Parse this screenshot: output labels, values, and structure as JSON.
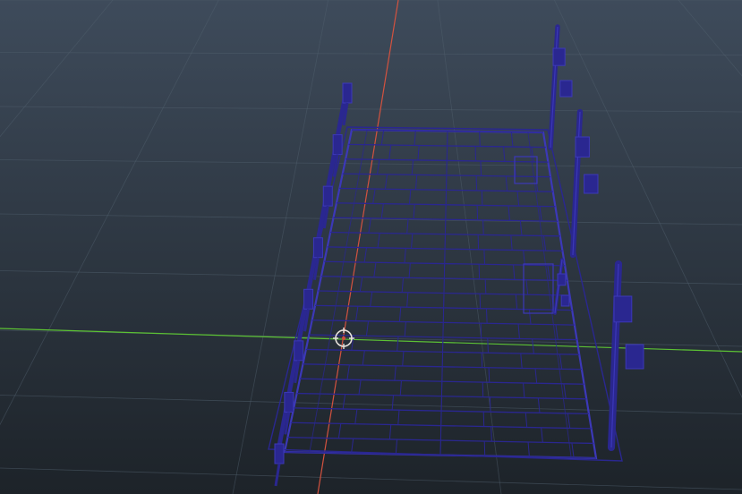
{
  "viewport": {
    "name": "3d-viewport",
    "background_top": "#3e4b5b",
    "background_bottom": "#1d2329",
    "grid_color": "#51606e",
    "x_axis_color": "#d3523f",
    "y_axis_color": "#5cc234",
    "wireframe_color": "#2a2790",
    "wireframe_highlight": "#3c38b8",
    "origin_gizmo_color": "#e8e2dc",
    "origin_gizmo_accent": "#d14b3c"
  },
  "scene": {
    "object": "bridge-wireframe",
    "plank_rows": 22,
    "lamp_posts": 4,
    "railing_posts": 8
  }
}
